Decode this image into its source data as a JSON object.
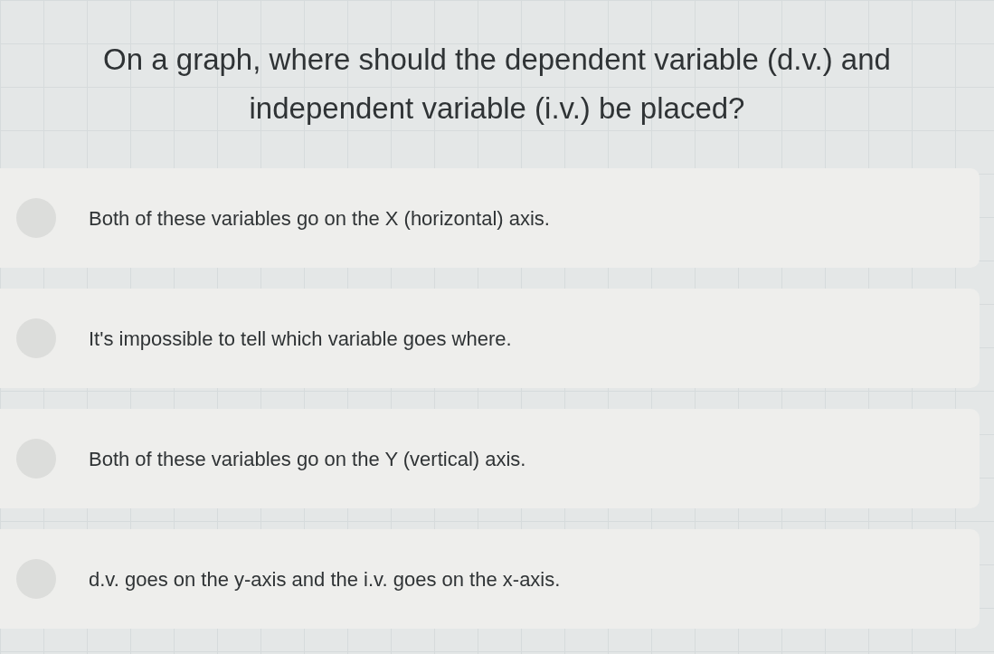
{
  "question": "On a graph, where should the dependent variable (d.v.) and independent variable (i.v.) be placed?",
  "options": [
    {
      "label": "Both of these variables go on the X (horizontal) axis.",
      "selected": false
    },
    {
      "label": "It's impossible to tell which variable goes where.",
      "selected": false
    },
    {
      "label": "Both of these variables go on the Y (vertical) axis.",
      "selected": false
    },
    {
      "label": "d.v. goes on the y-axis and the i.v. goes on the x-axis.",
      "selected": false
    }
  ]
}
